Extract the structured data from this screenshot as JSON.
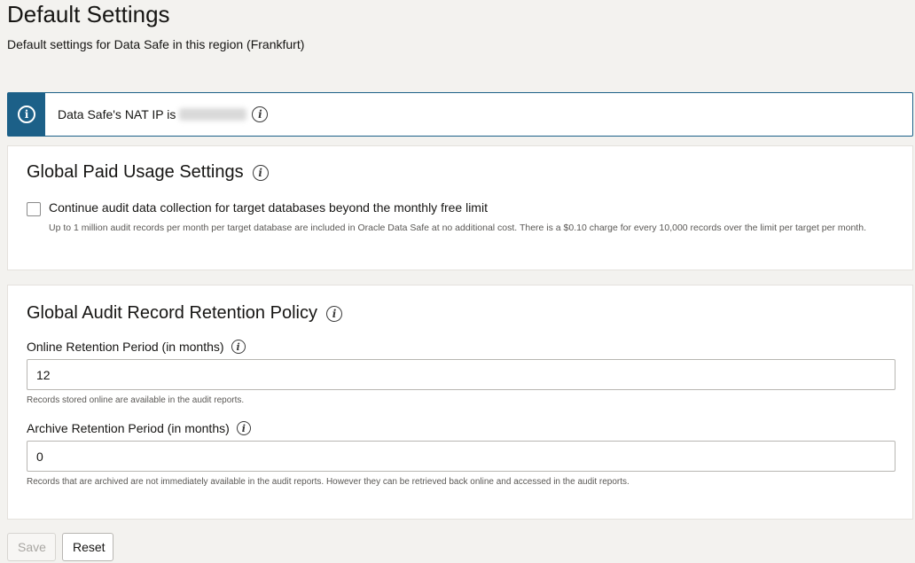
{
  "page": {
    "title": "Default Settings",
    "subtitle": "Default settings for Data Safe in this region (Frankfurt)"
  },
  "banner": {
    "text": "Data Safe's NAT IP is",
    "icon": "info-icon"
  },
  "paid_usage": {
    "title": "Global Paid Usage Settings",
    "checkbox_label": "Continue audit data collection for target databases beyond the monthly free limit",
    "checkbox_checked": false,
    "help": "Up to 1 million audit records per month per target database are included in Oracle Data Safe at no additional cost. There is a $0.10 charge for every 10,000 records over the limit per target per month."
  },
  "retention": {
    "title": "Global Audit Record Retention Policy",
    "online_label": "Online Retention Period (in months)",
    "online_value": "12",
    "online_help": "Records stored online are available in the audit reports.",
    "archive_label": "Archive Retention Period (in months)",
    "archive_value": "0",
    "archive_help": "Records that are archived are not immediately available in the audit reports. However they can be retrieved back online and accessed in the audit reports."
  },
  "actions": {
    "save_label": "Save",
    "reset_label": "Reset"
  },
  "colors": {
    "accent": "#1c6088",
    "background": "#f3f2ef"
  }
}
